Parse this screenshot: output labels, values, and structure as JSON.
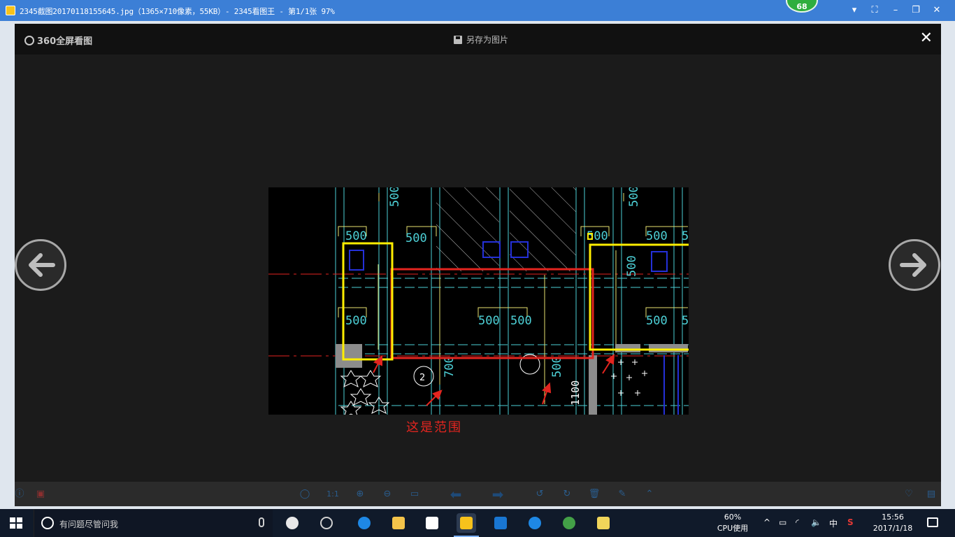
{
  "window": {
    "title": "2345截图20170118155645.jpg（1365×710像素，55KB）- 2345看图王 - 第1/1张 97%",
    "badge": "68"
  },
  "viewer": {
    "brand": "360全屏看图",
    "save_as": "另存为图片",
    "caption": "这是范围",
    "toolbar": {
      "one_to_one": "1:1"
    }
  },
  "drawing": {
    "dimensions": {
      "d500": "500",
      "d700": "700",
      "d1100": "1100",
      "d5": "5"
    },
    "axis_label": "2"
  },
  "taskbar": {
    "search_placeholder": "有问题尽管问我",
    "cpu_percent": "60%",
    "cpu_label": "CPU使用",
    "ime": "中",
    "time": "15:56",
    "date": "2017/1/18"
  },
  "colors": {
    "titlebar": "#3c7fd6",
    "highlight_yellow": "#ffee00",
    "highlight_red": "#e3251f",
    "cad_cyan": "#4dd0d6"
  }
}
